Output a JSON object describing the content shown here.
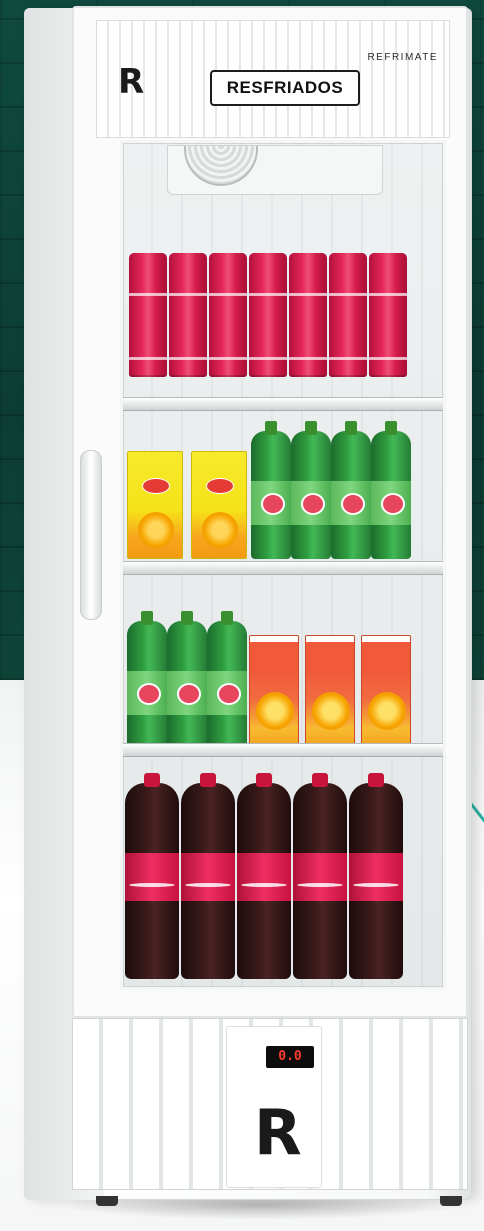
{
  "fridge": {
    "brand": "REFRIMATE",
    "sign_label": "RESFRIADOS",
    "logo_letter": "R",
    "display_reading": "0.0"
  }
}
